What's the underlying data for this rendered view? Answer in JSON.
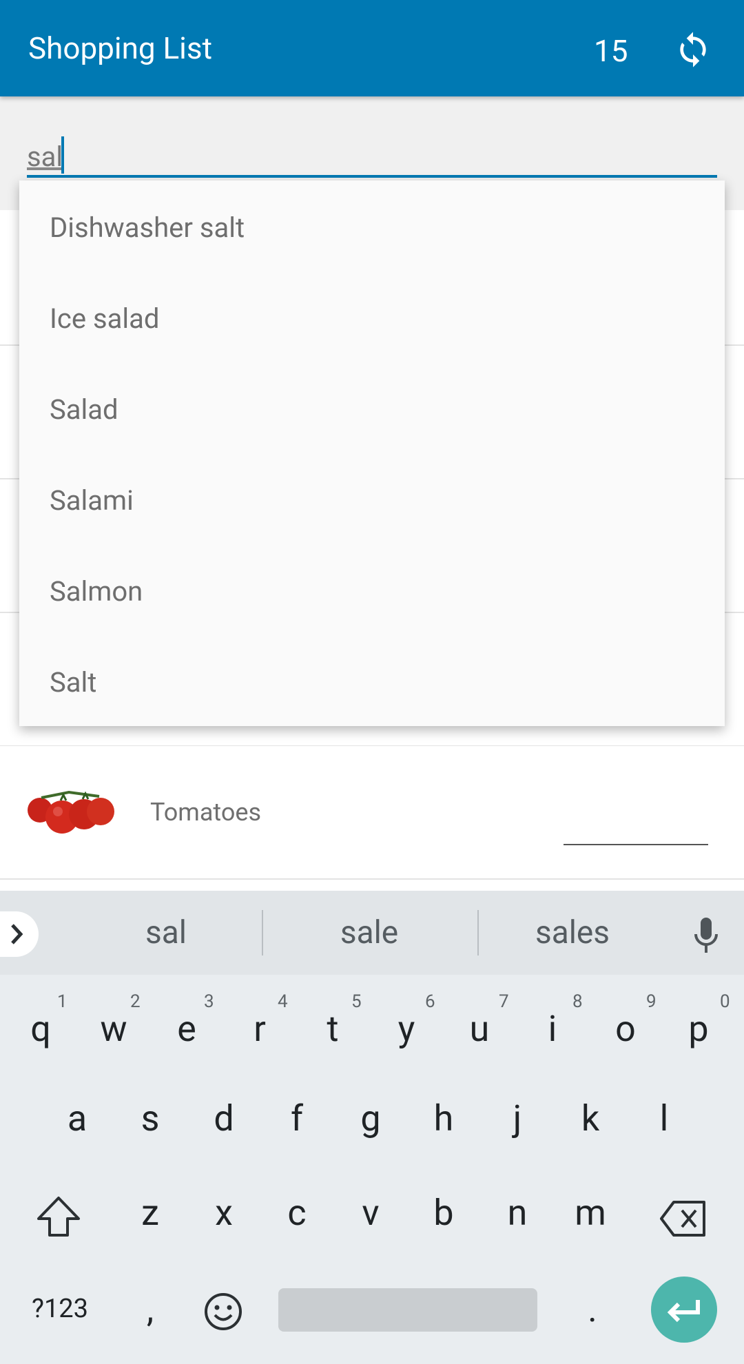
{
  "app_bar": {
    "title": "Shopping List",
    "count": "15",
    "sync_icon": "sync-icon"
  },
  "input": {
    "value": "sal"
  },
  "dropdown": {
    "items": [
      "Dishwasher salt",
      "Ice salad",
      "Salad",
      "Salami",
      "Salmon",
      "Salt"
    ]
  },
  "list": {
    "visible_item": "Tomatoes",
    "item_icon": "tomatoes-icon"
  },
  "keyboard": {
    "suggestions": [
      "sal",
      "sale",
      "sales"
    ],
    "row1": [
      "q",
      "w",
      "e",
      "r",
      "t",
      "y",
      "u",
      "i",
      "o",
      "p"
    ],
    "row1_numbers": [
      "1",
      "2",
      "3",
      "4",
      "5",
      "6",
      "7",
      "8",
      "9",
      "0"
    ],
    "row2": [
      "a",
      "s",
      "d",
      "f",
      "g",
      "h",
      "j",
      "k",
      "l"
    ],
    "row3": [
      "z",
      "x",
      "c",
      "v",
      "b",
      "n",
      "m"
    ],
    "symbols_key": "?123",
    "comma": ",",
    "period": "."
  },
  "colors": {
    "primary": "#0079b3",
    "enter": "#4db6ac"
  }
}
